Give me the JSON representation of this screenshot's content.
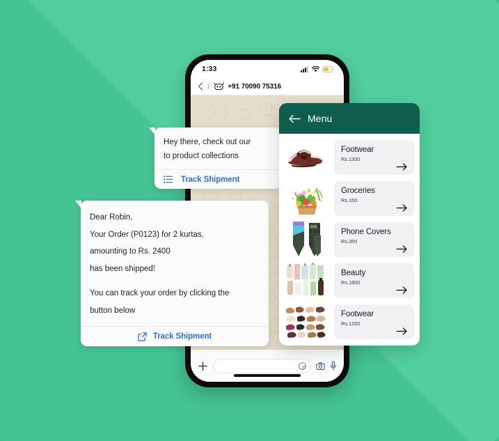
{
  "background": {
    "base_color": "#44c394",
    "highlight_color": "#53cf9f"
  },
  "phone": {
    "status_bar": {
      "time": "1:33",
      "icons": [
        "cellular-signal-icon",
        "wifi-icon",
        "battery-icon"
      ],
      "battery_color": "#f5c518"
    },
    "chat_header": {
      "back_icon": "back-chevron-icon",
      "unread_count": "1",
      "avatar_icon": "bot-avatar-icon",
      "contact": "+91 70090 75316"
    },
    "input_bar": {
      "attach_icon": "plus-icon",
      "placeholder": "",
      "value": "",
      "sticker_icon": "sticker-icon",
      "camera_icon": "camera-icon",
      "mic_icon": "microphone-icon"
    }
  },
  "bubbles": [
    {
      "lines": [
        "Hey there, check out our",
        "to product collections"
      ],
      "action_icon": "list-menu-icon",
      "action_label": "Track Shipment",
      "action_color": "#2f6fd0"
    },
    {
      "lines": [
        "Dear Robin,",
        "Your Order (P0123) for 2 kurtas,",
        "amounting to Rs. 2400",
        "has been shipped!"
      ],
      "lines2": [
        "You can track your order by clicking the",
        "button below"
      ],
      "action_icon": "external-link-icon",
      "action_label": "Track Shipment",
      "action_color": "#2f6fd0"
    }
  ],
  "menu": {
    "back_icon": "back-arrow-icon",
    "title": "Menu",
    "header_color": "#0f5d4f",
    "items": [
      {
        "thumb": "brown-loafers-image",
        "title": "Footwear",
        "price": "Rs.1200",
        "arrow": "arrow-right-icon"
      },
      {
        "thumb": "grocery-basket-image",
        "title": "Groceries",
        "price": "Rs.150",
        "arrow": "arrow-right-icon"
      },
      {
        "thumb": "phone-covers-image",
        "title": "Phone Covers",
        "price": "Rs.350",
        "arrow": "arrow-right-icon"
      },
      {
        "thumb": "beauty-products-image",
        "title": "Beauty",
        "price": "Rs.1800",
        "arrow": "arrow-right-icon"
      },
      {
        "thumb": "shoes-collection-image",
        "title": "Footwear",
        "price": "Rs.1200",
        "arrow": "arrow-right-icon"
      }
    ]
  }
}
